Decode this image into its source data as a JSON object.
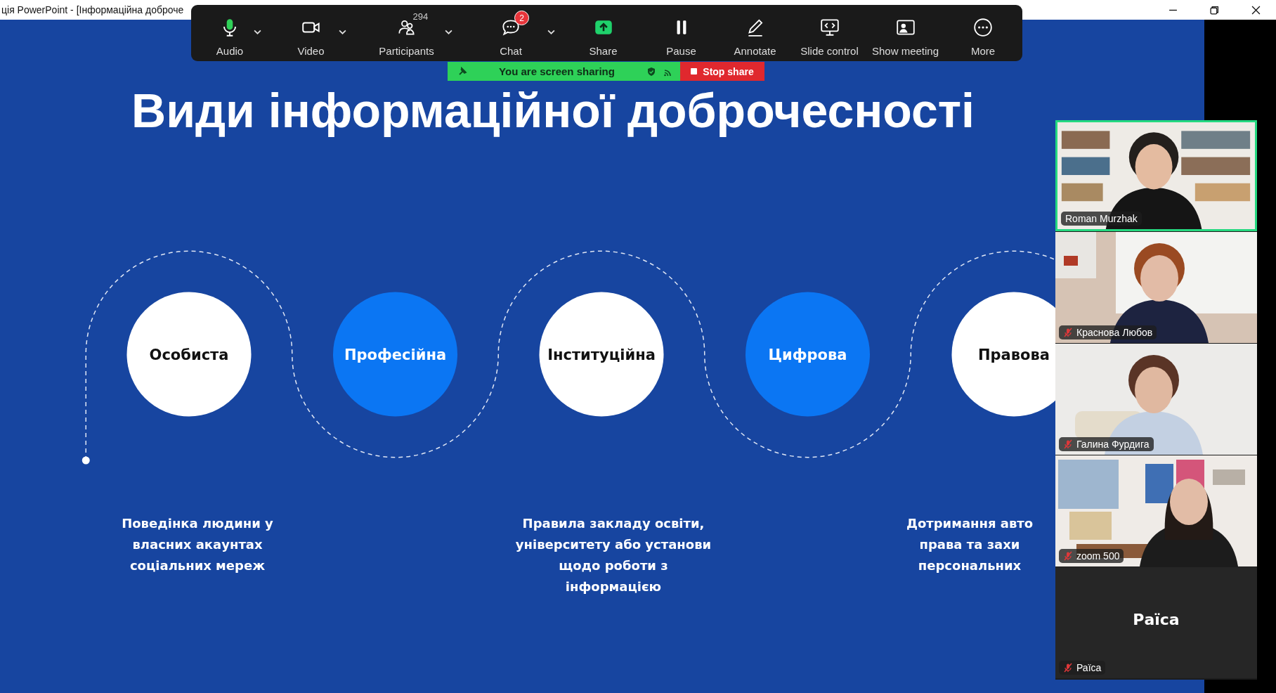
{
  "window": {
    "title": "ція PowerPoint - [Інформаційна доброче"
  },
  "toolbar": [
    {
      "kind": "audio",
      "label": "Audio",
      "dropdown": true,
      "muted": false
    },
    {
      "kind": "video",
      "label": "Video",
      "dropdown": true
    },
    {
      "kind": "participants",
      "label": "Participants",
      "dropdown": true,
      "count": "294"
    },
    {
      "kind": "chat",
      "label": "Chat",
      "dropdown": true,
      "badge": "2"
    },
    {
      "kind": "share",
      "label": "Share",
      "dropdown": false
    },
    {
      "kind": "pause",
      "label": "Pause",
      "dropdown": false
    },
    {
      "kind": "annotate",
      "label": "Annotate",
      "dropdown": false
    },
    {
      "kind": "slide",
      "label": "Slide control",
      "dropdown": false
    },
    {
      "kind": "meeting",
      "label": "Show meeting",
      "dropdown": false
    },
    {
      "kind": "more",
      "label": "More",
      "dropdown": false
    }
  ],
  "sharing_bar": {
    "status": "You are screen sharing",
    "stop_label": "Stop share"
  },
  "slide": {
    "title": "Види інформаційної доброчесності",
    "stages": [
      {
        "label": "Особиста",
        "kind": "light"
      },
      {
        "label": "Професійна",
        "kind": "accent"
      },
      {
        "label": "Інституційна",
        "kind": "light"
      },
      {
        "label": "Цифрова",
        "kind": "accent"
      },
      {
        "label": "Правова",
        "kind": "light"
      }
    ],
    "descriptions": [
      {
        "lines": [
          "Поведінка людини у",
          "власних акаунтах",
          "соціальних мереж"
        ]
      },
      {
        "lines": [
          "Правила закладу освіти,",
          "університету або установи",
          "щодо роботи з",
          "інформацією"
        ]
      },
      {
        "lines": [
          "Дотримання авто",
          "права та захи",
          "персональних"
        ]
      }
    ]
  },
  "participants": [
    {
      "name": "Roman Murzhak",
      "kind": "video",
      "muted": false,
      "active_speaker": true
    },
    {
      "name": "Краснова Любов",
      "kind": "video",
      "muted": true,
      "active_speaker": false
    },
    {
      "name": "Галина Фурдига",
      "kind": "video",
      "muted": true,
      "active_speaker": false
    },
    {
      "name": "zoom 500",
      "kind": "video",
      "muted": true,
      "active_speaker": false
    },
    {
      "name": "Раїса",
      "kind": "avatar",
      "avatar_text": "Раїса",
      "muted": true,
      "active_speaker": false
    }
  ]
}
